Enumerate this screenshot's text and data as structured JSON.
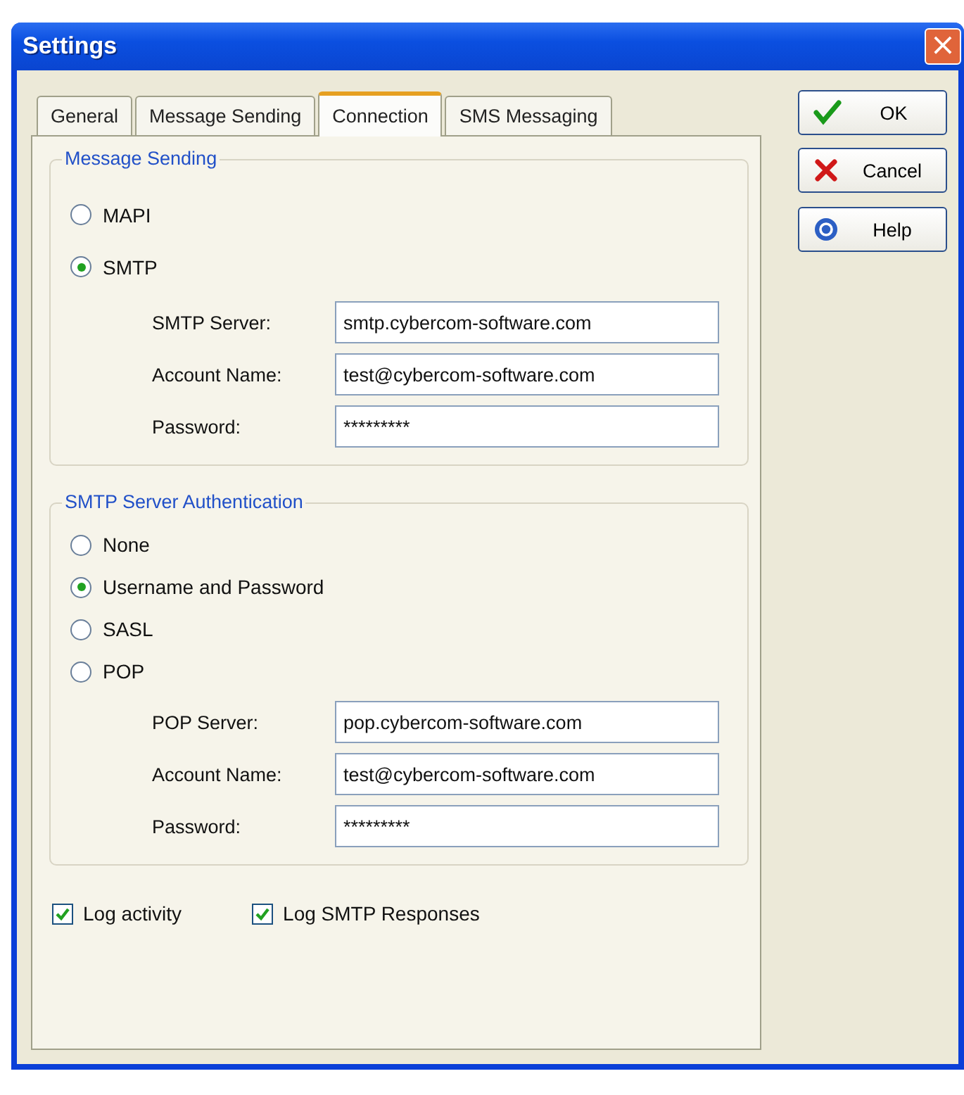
{
  "window": {
    "title": "Settings",
    "close": "×"
  },
  "tabs": [
    {
      "label": "General",
      "selected": false
    },
    {
      "label": "Message Sending",
      "selected": false
    },
    {
      "label": "Connection",
      "selected": true
    },
    {
      "label": "SMS Messaging",
      "selected": false
    }
  ],
  "groups": [
    {
      "title": "Message Sending",
      "options": [
        {
          "label": "MAPI",
          "selected": false
        },
        {
          "label": "SMTP",
          "selected": true
        }
      ],
      "fields": [
        {
          "label": "SMTP Server:",
          "value": "smtp.cybercom-software.com"
        },
        {
          "label": "Account Name:",
          "value": "test@cybercom-software.com"
        },
        {
          "label": "Password:",
          "value": "*********"
        }
      ]
    },
    {
      "title": "SMTP Server Authentication",
      "options": [
        {
          "label": "None",
          "selected": false
        },
        {
          "label": "Username and Password",
          "selected": true
        },
        {
          "label": "SASL",
          "selected": false
        },
        {
          "label": "POP",
          "selected": false
        }
      ],
      "fields": [
        {
          "label": "POP Server:",
          "value": "pop.cybercom-software.com"
        },
        {
          "label": "Account Name:",
          "value": "test@cybercom-software.com"
        },
        {
          "label": "Password:",
          "value": "*********"
        }
      ]
    }
  ],
  "checkboxes": [
    {
      "label": "Log activity",
      "checked": true
    },
    {
      "label": "Log SMTP Responses",
      "checked": true
    }
  ],
  "buttons": [
    {
      "kind": "ok",
      "label": "OK"
    },
    {
      "kind": "cancel",
      "label": "Cancel"
    },
    {
      "kind": "help",
      "label": "Help"
    }
  ]
}
